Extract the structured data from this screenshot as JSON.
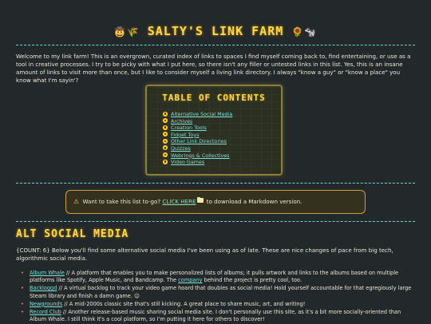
{
  "header": {
    "title": "SALTY'S LINK FARM",
    "icon_left": "cowboy-hat-sheep-icon",
    "icon_right": "sunflower-cow-icon"
  },
  "intro": "Welcome to my link farm! This is an overgrown, curated index of links to spaces I find myself coming back to, find entertaining, or use as a tool in creative processes. I try to be picky with what I put here, so there isn't any filler or untested links in this list. Yes, this is an insane amount of links to visit more than once, but I like to consider myself a living link directory. I always \"know a guy\" or \"know a place\" you know what I'm sayin'?",
  "toc": {
    "title": "TABLE OF CONTENTS",
    "items": [
      "Alternative Social Media",
      "Archives",
      "Creation Tools",
      "Fidget Toys",
      "Other Link Directories",
      "Quizzes",
      "Webrings & Collectives",
      "Video Games"
    ]
  },
  "notice": {
    "before": "Want to take this list to-go?",
    "link": "CLICK HERE",
    "after": "to download a Markdown version."
  },
  "section": {
    "title": "ALT SOCIAL MEDIA",
    "description": "{COUNT: 6} Below you'll find some alternative social media I've been using as of late. These are nice changes of pace from big tech, algorithmic social media.",
    "entries": [
      {
        "name": "Album Whale",
        "text_a": " // A platform that enables you to make personalized lists of albums; it pulls artwork and links to the albums based on multiple platforms like Spotify, Apple Music, and Bandcamp. The ",
        "link2": "company",
        "text_b": " behind the project is pretty cool, too."
      },
      {
        "name": "Backloggd",
        "text_a": " // A virtual backlog to track your video game hoard that doubles as social media! Hold yourself accountable for that egregiously large Steam library and finish a damn game. 😉",
        "link2": "",
        "text_b": ""
      },
      {
        "name": "Newgrounds",
        "text_a": " // A mid-2000s classic site that's still kicking. A great place to share music, art, and writing!",
        "link2": "",
        "text_b": ""
      },
      {
        "name": "Record Club",
        "text_a": " // Another release-based music sharing social media site. I don't personally use this site, as it's a bit more socially-oriented than Album Whale. I still think it's a cool platform, so I'm putting it here for others to discover!",
        "link2": "",
        "text_b": ""
      }
    ]
  },
  "colors": {
    "background": "#23282b",
    "accent_yellow": "#ffd84a",
    "link_teal": "#7fe0d4",
    "divider": "#6fd6c8"
  }
}
